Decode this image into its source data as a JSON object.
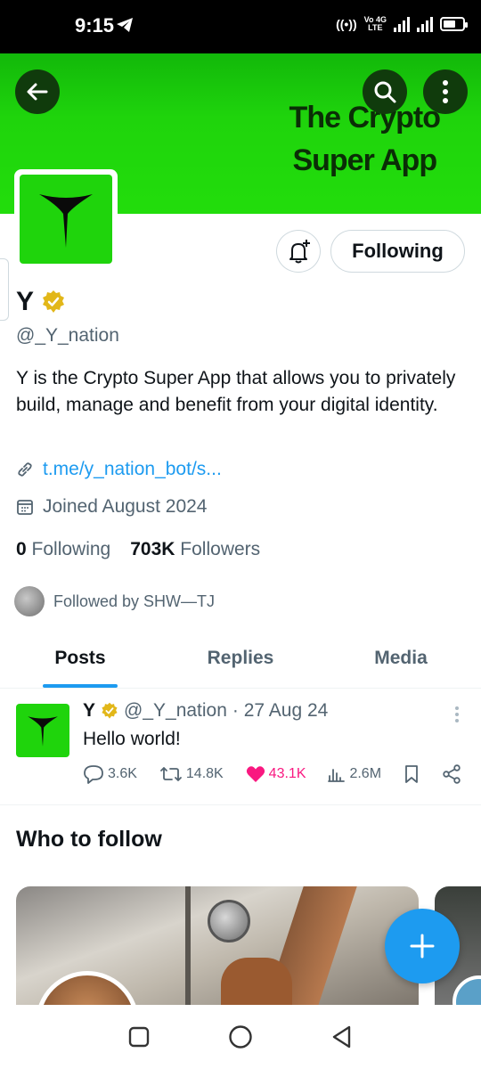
{
  "status_bar": {
    "time": "9:15",
    "network_label_top": "Vo 4G",
    "network_label_bottom": "LTE",
    "icons": [
      "telegram-icon",
      "hotspot-icon",
      "signal-icon",
      "battery-icon"
    ],
    "battery_level": 0.65
  },
  "banner": {
    "title_line1": "The Crypto",
    "title_line2": "Super App",
    "color": "#1fd40c"
  },
  "profile": {
    "name": "Y",
    "handle": "@_Y_nation",
    "bio": "Y is the Crypto Super App that allows you to privately build, manage and benefit from your digital identity.",
    "link": "t.me/y_nation_bot/s...",
    "joined": "Joined August 2024",
    "following_count": "0",
    "following_label": "Following",
    "followers_count": "703K",
    "followers_label": "Followers",
    "followed_by": "Followed by SHW—TJ",
    "follow_button_label": "Following"
  },
  "tabs": [
    {
      "label": "Posts",
      "active": true
    },
    {
      "label": "Replies",
      "active": false
    },
    {
      "label": "Media",
      "active": false
    }
  ],
  "post": {
    "name": "Y",
    "handle": "@_Y_nation",
    "date": "· 27 Aug 24",
    "text": "Hello world!",
    "replies": "3.6K",
    "reposts": "14.8K",
    "likes": "43.1K",
    "views": "2.6M"
  },
  "who_to_follow": {
    "title": "Who to follow"
  },
  "colors": {
    "accent": "#1d9bf0",
    "like": "#f91880",
    "brand_green": "#1fd40c",
    "verified_gold": "#e2b719"
  }
}
